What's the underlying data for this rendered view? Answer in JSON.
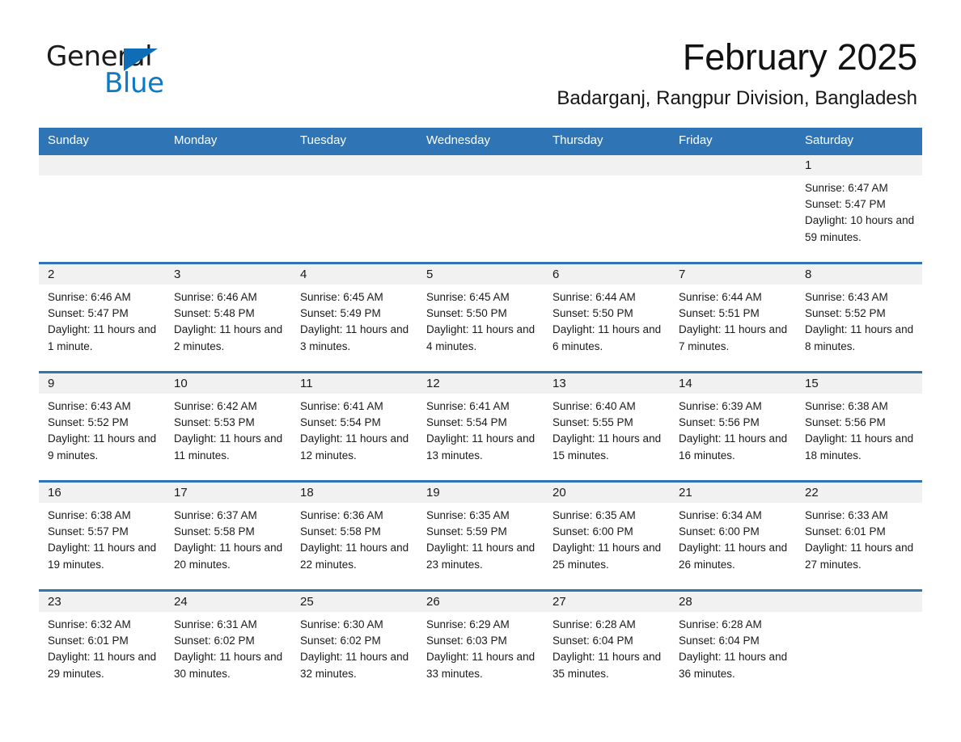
{
  "brand": {
    "name_part1": "General",
    "name_part2": "Blue",
    "accent_color": "#0e7ac4",
    "triangle_color": "#0e6db5"
  },
  "header": {
    "title": "February 2025",
    "location": "Badarganj, Rangpur Division, Bangladesh"
  },
  "theme": {
    "header_blue": "#2f75b5",
    "daynum_band": "#f1f1f1",
    "text": "#1a1a1a"
  },
  "weekdays": [
    "Sunday",
    "Monday",
    "Tuesday",
    "Wednesday",
    "Thursday",
    "Friday",
    "Saturday"
  ],
  "labels": {
    "sunrise_prefix": "Sunrise:",
    "sunset_prefix": "Sunset:",
    "daylight_prefix": "Daylight:"
  },
  "weeks": [
    [
      {
        "day": "",
        "empty": true
      },
      {
        "day": "",
        "empty": true
      },
      {
        "day": "",
        "empty": true
      },
      {
        "day": "",
        "empty": true
      },
      {
        "day": "",
        "empty": true
      },
      {
        "day": "",
        "empty": true
      },
      {
        "day": "1",
        "sunrise": "Sunrise: 6:47 AM",
        "sunset": "Sunset: 5:47 PM",
        "daylight": "Daylight: 10 hours and 59 minutes."
      }
    ],
    [
      {
        "day": "2",
        "sunrise": "Sunrise: 6:46 AM",
        "sunset": "Sunset: 5:47 PM",
        "daylight": "Daylight: 11 hours and 1 minute."
      },
      {
        "day": "3",
        "sunrise": "Sunrise: 6:46 AM",
        "sunset": "Sunset: 5:48 PM",
        "daylight": "Daylight: 11 hours and 2 minutes."
      },
      {
        "day": "4",
        "sunrise": "Sunrise: 6:45 AM",
        "sunset": "Sunset: 5:49 PM",
        "daylight": "Daylight: 11 hours and 3 minutes."
      },
      {
        "day": "5",
        "sunrise": "Sunrise: 6:45 AM",
        "sunset": "Sunset: 5:50 PM",
        "daylight": "Daylight: 11 hours and 4 minutes."
      },
      {
        "day": "6",
        "sunrise": "Sunrise: 6:44 AM",
        "sunset": "Sunset: 5:50 PM",
        "daylight": "Daylight: 11 hours and 6 minutes."
      },
      {
        "day": "7",
        "sunrise": "Sunrise: 6:44 AM",
        "sunset": "Sunset: 5:51 PM",
        "daylight": "Daylight: 11 hours and 7 minutes."
      },
      {
        "day": "8",
        "sunrise": "Sunrise: 6:43 AM",
        "sunset": "Sunset: 5:52 PM",
        "daylight": "Daylight: 11 hours and 8 minutes."
      }
    ],
    [
      {
        "day": "9",
        "sunrise": "Sunrise: 6:43 AM",
        "sunset": "Sunset: 5:52 PM",
        "daylight": "Daylight: 11 hours and 9 minutes."
      },
      {
        "day": "10",
        "sunrise": "Sunrise: 6:42 AM",
        "sunset": "Sunset: 5:53 PM",
        "daylight": "Daylight: 11 hours and 11 minutes."
      },
      {
        "day": "11",
        "sunrise": "Sunrise: 6:41 AM",
        "sunset": "Sunset: 5:54 PM",
        "daylight": "Daylight: 11 hours and 12 minutes."
      },
      {
        "day": "12",
        "sunrise": "Sunrise: 6:41 AM",
        "sunset": "Sunset: 5:54 PM",
        "daylight": "Daylight: 11 hours and 13 minutes."
      },
      {
        "day": "13",
        "sunrise": "Sunrise: 6:40 AM",
        "sunset": "Sunset: 5:55 PM",
        "daylight": "Daylight: 11 hours and 15 minutes."
      },
      {
        "day": "14",
        "sunrise": "Sunrise: 6:39 AM",
        "sunset": "Sunset: 5:56 PM",
        "daylight": "Daylight: 11 hours and 16 minutes."
      },
      {
        "day": "15",
        "sunrise": "Sunrise: 6:38 AM",
        "sunset": "Sunset: 5:56 PM",
        "daylight": "Daylight: 11 hours and 18 minutes."
      }
    ],
    [
      {
        "day": "16",
        "sunrise": "Sunrise: 6:38 AM",
        "sunset": "Sunset: 5:57 PM",
        "daylight": "Daylight: 11 hours and 19 minutes."
      },
      {
        "day": "17",
        "sunrise": "Sunrise: 6:37 AM",
        "sunset": "Sunset: 5:58 PM",
        "daylight": "Daylight: 11 hours and 20 minutes."
      },
      {
        "day": "18",
        "sunrise": "Sunrise: 6:36 AM",
        "sunset": "Sunset: 5:58 PM",
        "daylight": "Daylight: 11 hours and 22 minutes."
      },
      {
        "day": "19",
        "sunrise": "Sunrise: 6:35 AM",
        "sunset": "Sunset: 5:59 PM",
        "daylight": "Daylight: 11 hours and 23 minutes."
      },
      {
        "day": "20",
        "sunrise": "Sunrise: 6:35 AM",
        "sunset": "Sunset: 6:00 PM",
        "daylight": "Daylight: 11 hours and 25 minutes."
      },
      {
        "day": "21",
        "sunrise": "Sunrise: 6:34 AM",
        "sunset": "Sunset: 6:00 PM",
        "daylight": "Daylight: 11 hours and 26 minutes."
      },
      {
        "day": "22",
        "sunrise": "Sunrise: 6:33 AM",
        "sunset": "Sunset: 6:01 PM",
        "daylight": "Daylight: 11 hours and 27 minutes."
      }
    ],
    [
      {
        "day": "23",
        "sunrise": "Sunrise: 6:32 AM",
        "sunset": "Sunset: 6:01 PM",
        "daylight": "Daylight: 11 hours and 29 minutes."
      },
      {
        "day": "24",
        "sunrise": "Sunrise: 6:31 AM",
        "sunset": "Sunset: 6:02 PM",
        "daylight": "Daylight: 11 hours and 30 minutes."
      },
      {
        "day": "25",
        "sunrise": "Sunrise: 6:30 AM",
        "sunset": "Sunset: 6:02 PM",
        "daylight": "Daylight: 11 hours and 32 minutes."
      },
      {
        "day": "26",
        "sunrise": "Sunrise: 6:29 AM",
        "sunset": "Sunset: 6:03 PM",
        "daylight": "Daylight: 11 hours and 33 minutes."
      },
      {
        "day": "27",
        "sunrise": "Sunrise: 6:28 AM",
        "sunset": "Sunset: 6:04 PM",
        "daylight": "Daylight: 11 hours and 35 minutes."
      },
      {
        "day": "28",
        "sunrise": "Sunrise: 6:28 AM",
        "sunset": "Sunset: 6:04 PM",
        "daylight": "Daylight: 11 hours and 36 minutes."
      },
      {
        "day": "",
        "empty": true,
        "blank": true
      }
    ]
  ]
}
